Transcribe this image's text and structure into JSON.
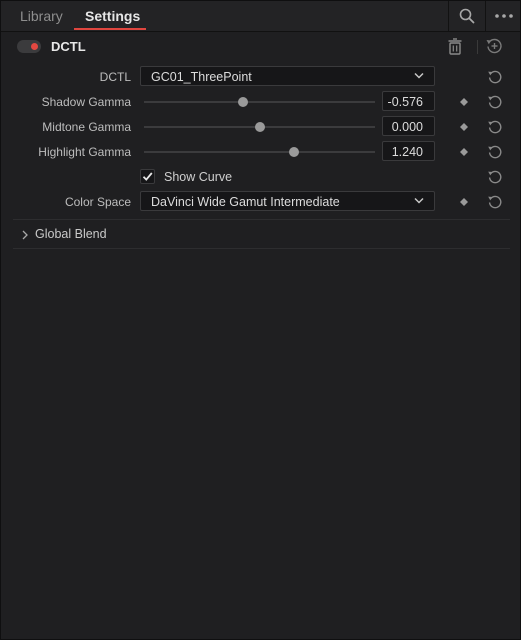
{
  "tabs": [
    {
      "label": "Library",
      "active": false
    },
    {
      "label": "Settings",
      "active": true
    }
  ],
  "toolbar": {
    "search_icon": "search-icon",
    "more_icon": "more-options-icon"
  },
  "node": {
    "title": "DCTL",
    "enabled": true
  },
  "fields": {
    "dctl": {
      "label": "DCTL",
      "value": "GC01_ThreePoint"
    },
    "shadow_gamma": {
      "label": "Shadow Gamma",
      "value": "-0.576",
      "level": 0.43
    },
    "midtone_gamma": {
      "label": "Midtone Gamma",
      "value": "0.000",
      "level": 0.5
    },
    "highlight_gamma": {
      "label": "Highlight Gamma",
      "value": "1.240",
      "level": 0.65
    },
    "show_curve": {
      "label": "Show Curve",
      "checked": true
    },
    "color_space": {
      "label": "Color Space",
      "value": "DaVinci Wide Gamut Intermediate"
    }
  },
  "global_blend": {
    "label": "Global Blend",
    "expanded": false
  },
  "colors": {
    "accent": "#e0463f",
    "toggle_on": "#e34841",
    "background": "#1f1f21"
  }
}
